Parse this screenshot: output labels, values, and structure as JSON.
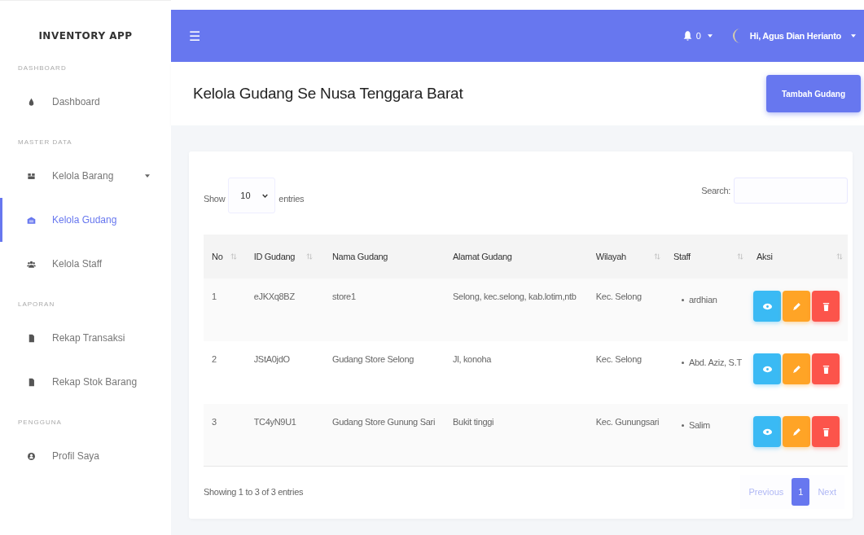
{
  "sidebar": {
    "brand": "INVENTORY APP",
    "sections": [
      {
        "heading": "DASHBOARD",
        "items": [
          {
            "label": "Dashboard",
            "selected": false,
            "expandable": false
          }
        ]
      },
      {
        "heading": "MASTER DATA",
        "items": [
          {
            "label": "Kelola Barang",
            "selected": false,
            "expandable": true
          },
          {
            "label": "Kelola Gudang",
            "selected": true,
            "expandable": false
          },
          {
            "label": "Kelola Staff",
            "selected": false,
            "expandable": false
          }
        ]
      },
      {
        "heading": "LAPORAN",
        "items": [
          {
            "label": "Rekap Transaksi",
            "selected": false,
            "expandable": false
          },
          {
            "label": "Rekap Stok Barang",
            "selected": false,
            "expandable": false
          }
        ]
      },
      {
        "heading": "PENGGUNA",
        "items": [
          {
            "label": "Profil Saya",
            "selected": false,
            "expandable": false
          }
        ]
      }
    ]
  },
  "topbar": {
    "menu_glyph": "☰",
    "notification_count": "0",
    "user_greeting": "Hi, Agus Dian Herianto"
  },
  "page": {
    "title": "Kelola Gudang Se Nusa Tenggara Barat",
    "add_button": "Tambah Gudang"
  },
  "table_controls": {
    "show_label": "Show",
    "page_size": "10",
    "entries_label": "entries",
    "search_label": "Search:"
  },
  "table": {
    "columns": [
      {
        "label": "No",
        "sortable": true
      },
      {
        "label": "ID Gudang",
        "sortable": true
      },
      {
        "label": "Nama Gudang",
        "sortable": false
      },
      {
        "label": "Alamat Gudang",
        "sortable": false
      },
      {
        "label": "Wilayah",
        "sortable": true
      },
      {
        "label": "Staff",
        "sortable": true
      },
      {
        "label": "Aksi",
        "sortable": true
      }
    ],
    "rows": [
      {
        "no": "1",
        "id": "eJKXq8BZ",
        "nama": "store1",
        "alamat": "Selong, kec.selong, kab.lotim,ntb",
        "wilayah": "Kec. Selong",
        "staff": [
          "ardhian"
        ]
      },
      {
        "no": "2",
        "id": "JStA0jdO",
        "nama": "Gudang Store Selong",
        "alamat": "Jl, konoha",
        "wilayah": "Kec. Selong",
        "staff": [
          "Abd. Aziz, S.T"
        ]
      },
      {
        "no": "3",
        "id": "TC4yN9U1",
        "nama": "Gudang Store Gunung Sari",
        "alamat": "Bukit tinggi",
        "wilayah": "Kec. Gunungsari",
        "staff": [
          "Salim"
        ]
      }
    ]
  },
  "footer": {
    "info": "Showing 1 to 3 of 3 entries",
    "previous": {
      "label": "Previous",
      "disabled": true
    },
    "pages": [
      {
        "label": "1",
        "selected": true
      }
    ],
    "next": {
      "label": "Next",
      "disabled": true
    }
  }
}
